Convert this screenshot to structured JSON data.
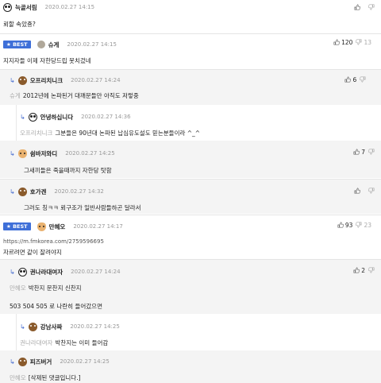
{
  "comments": [
    {
      "nick": "늑골서림",
      "date": "2020.02.27 14:15",
      "text": "뢰할 속았죵?"
    },
    {
      "badge": "BEST",
      "nick": "슈게",
      "date": "2020.02.27 14:15",
      "text": "지지자들 이제 자한당드립 못치겄네",
      "up": "120",
      "down": "13"
    },
    {
      "nick": "오프리치니크",
      "date": "2020.02.27 14:24",
      "reply_to": "슈게",
      "text": "2012년에 논파된거 대깨문들만 아직도 저렇중",
      "up": "6",
      "down": "0"
    },
    {
      "nick": "안녕하십니다",
      "date": "2020.02.27 14:36",
      "reply_to": "오프리치니크",
      "text": "그분들은 90년대 논파된 납심유도설도 믿는분들이라 ^_^"
    },
    {
      "nick": "쉼바저와디",
      "date": "2020.02.27 14:25",
      "reply_to": "슈게",
      "text": "그새끼들은 죽을때까지 자한당 탓함",
      "up": "7",
      "down": "0"
    },
    {
      "nick": "호가겐",
      "date": "2020.02.27 14:32",
      "reply_to": "슈게",
      "text": "그러도 칭ㅋㅋ 뢰구조가 일반사람들하곤 달라서"
    },
    {
      "badge": "BEST",
      "nick": "만혜오",
      "date": "2020.02.27 14:17",
      "link": "https://m.fmkorea.com/2759596695",
      "text": "자르려면 같이 잘려야지",
      "up": "93",
      "down": "23"
    },
    {
      "nick": "권나라대여자",
      "date": "2020.02.27 14:24",
      "reply_to": "만혜오",
      "text": "박찬지 문찬지 신찬지",
      "text2": "503 504 505 로 나란히 들어갔으면",
      "up": "2",
      "down": "0"
    },
    {
      "nick": "강남사짜",
      "date": "2020.02.27 14:25",
      "reply_to": "권나라대여자",
      "text": "박찬지는 이미 들어감"
    },
    {
      "nick": "피즈버거",
      "date": "2020.02.27 14:25",
      "reply_to": "만혜오",
      "text": "[삭제된 댓글입니다.]"
    }
  ],
  "colors": {
    "accent": "#3e6fd8",
    "shade": "#f4f4f4"
  },
  "icons": {
    "up": "thumbs-up-icon",
    "down": "thumbs-down-icon",
    "reply": "reply-arrow-icon"
  }
}
